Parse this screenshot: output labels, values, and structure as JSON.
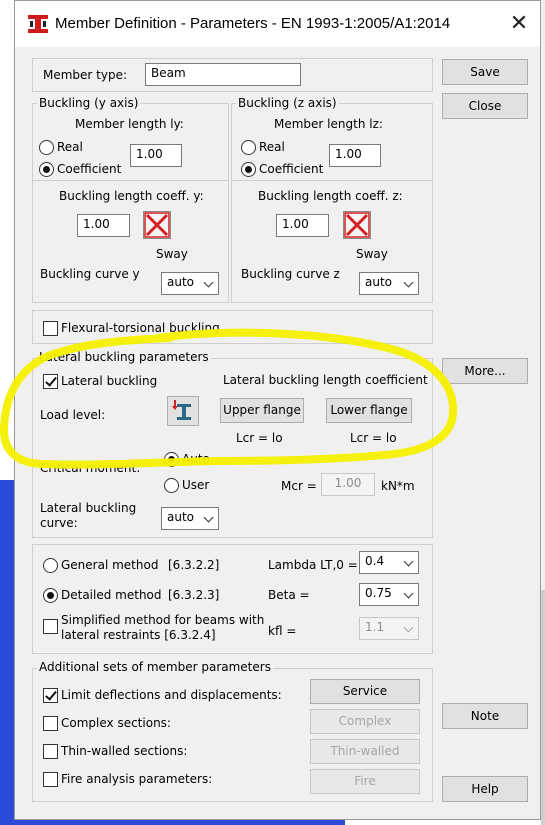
{
  "window": {
    "title": "Member Definition - Parameters - EN 1993-1:2005/A1:2014",
    "close_glyph": "✕"
  },
  "member_type": {
    "label": "Member type:",
    "value": "Beam"
  },
  "buttons": {
    "save": "Save",
    "close": "Close",
    "more": "More...",
    "note": "Note",
    "help": "Help"
  },
  "buckling_y": {
    "title": "Buckling (y axis)",
    "member_length_label": "Member length ly:",
    "real_label": "Real",
    "coefficient_label": "Coefficient",
    "selected": "coefficient",
    "length_value": "1.00",
    "coeff_label": "Buckling length coeff. y:",
    "coeff_value": "1.00",
    "sway_label": "Sway",
    "curve_label": "Buckling curve y",
    "curve_value": "auto"
  },
  "buckling_z": {
    "title": "Buckling (z axis)",
    "member_length_label": "Member length lz:",
    "real_label": "Real",
    "coefficient_label": "Coefficient",
    "selected": "coefficient",
    "length_value": "1.00",
    "coeff_label": "Buckling length coeff. z:",
    "coeff_value": "1.00",
    "sway_label": "Sway",
    "curve_label": "Buckling curve z",
    "curve_value": "auto"
  },
  "flexural_torsional": {
    "label": "Flexural-torsional buckling",
    "checked": false
  },
  "lateral": {
    "title": "Lateral buckling parameters",
    "lateral_buckling_label": "Lateral buckling",
    "lateral_buckling_checked": true,
    "coeff_title": "Lateral buckling length coefficient",
    "load_level_label": "Load level:",
    "upper_flange": "Upper flange",
    "lower_flange": "Lower flange",
    "lcr_upper": "Lcr =  lo",
    "lcr_lower": "Lcr =  lo",
    "critical_moment_label": "Critical moment:",
    "auto_label": "Auto",
    "user_label": "User",
    "critical_selected": "auto",
    "mcr_label": "Mcr =",
    "mcr_value": "1.00",
    "mcr_unit": "kN*m",
    "curve_label_1": "Lateral buckling",
    "curve_label_2": "curve:",
    "curve_value": "auto"
  },
  "methods": {
    "general_label": "General method",
    "general_ref": "[6.3.2.2]",
    "detailed_label": "Detailed method",
    "detailed_ref": "[6.3.2.3]",
    "selected": "detailed",
    "simplified_label_1": "Simplified method for beams with",
    "simplified_label_2": "lateral restraints [6.3.2.4]",
    "simplified_checked": false,
    "lambda_label": "Lambda LT,0 =",
    "lambda_value": "0.4",
    "beta_label": "Beta =",
    "beta_value": "0.75",
    "kfl_label": "kfl =",
    "kfl_value": "1.1"
  },
  "additional": {
    "title": "Additional sets of member parameters",
    "limit_label": "Limit deflections and displacements:",
    "limit_checked": true,
    "complex_label": "Complex sections:",
    "thin_label": "Thin-walled sections:",
    "fire_label": "Fire analysis parameters:",
    "service_btn": "Service",
    "complex_btn": "Complex",
    "thin_btn": "Thin-walled",
    "fire_btn": "Fire"
  },
  "colors": {
    "highlight": "#f4f000",
    "sway_red": "#d42020",
    "app_icon_red": "#d21c1c",
    "bg_blue": "#2c4ad8"
  },
  "icons": {
    "app": "robot-app-icon",
    "sway": "red-x-sway-icon",
    "load_level": "i-beam-load-icon"
  }
}
